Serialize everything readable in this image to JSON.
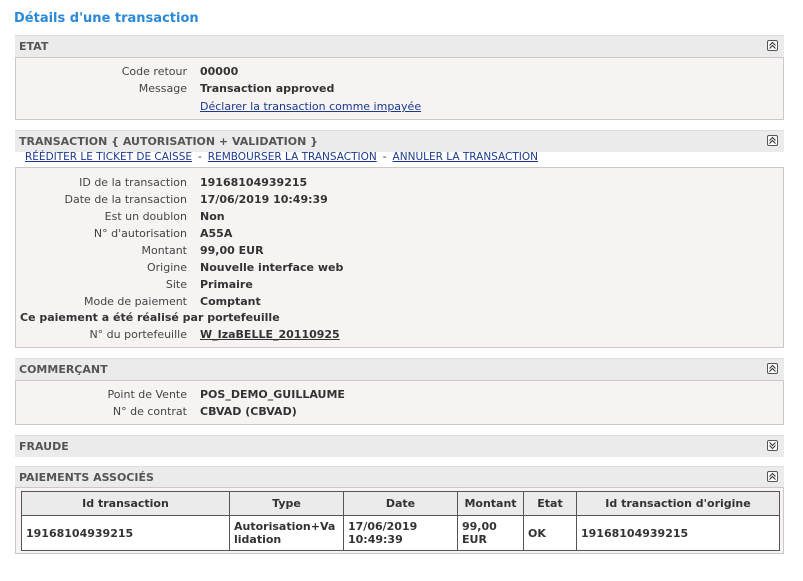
{
  "page": {
    "title": "Détails d'une transaction"
  },
  "etat": {
    "header": "ETAT",
    "code_retour_label": "Code retour",
    "code_retour_value": "00000",
    "message_label": "Message",
    "message_value": "Transaction approved",
    "declare_link": "Déclarer la transaction comme impayée"
  },
  "transaction": {
    "header": "TRANSACTION { AUTORISATION + VALIDATION }",
    "actions": [
      "RÉÉDITER LE TICKET DE CAISSE",
      "REMBOURSER LA TRANSACTION",
      "ANNULER LA TRANSACTION"
    ],
    "separator": "-",
    "fields": [
      {
        "label": "ID de la transaction",
        "value": "19168104939215"
      },
      {
        "label": "Date de la transaction",
        "value": "17/06/2019 10:49:39"
      },
      {
        "label": "Est un doublon",
        "value": "Non"
      },
      {
        "label": "N° d'autorisation",
        "value": "A55A"
      },
      {
        "label": "Montant",
        "value": "99,00 EUR"
      },
      {
        "label": "Origine",
        "value": "Nouvelle interface web"
      },
      {
        "label": "Site",
        "value": "Primaire"
      },
      {
        "label": "Mode de paiement",
        "value": "Comptant"
      }
    ],
    "wallet_note": "Ce paiement a été réalisé par portefeuille",
    "wallet_label": "N° du portefeuille",
    "wallet_value": "W_IzaBELLE_20110925"
  },
  "commercant": {
    "header": "COMMERÇANT",
    "pos_label": "Point de Vente",
    "pos_value": "POS_DEMO_GUILLAUME",
    "contract_label": "N° de contrat",
    "contract_value": "CBVAD (CBVAD)"
  },
  "fraude": {
    "header": "FRAUDE"
  },
  "paiements": {
    "header": "PAIEMENTS ASSOCIÉS",
    "columns": [
      "Id transaction",
      "Type",
      "Date",
      "Montant",
      "Etat",
      "Id transaction d'origine"
    ],
    "rows": [
      [
        "19168104939215",
        "Autorisation+Validation",
        "17/06/2019 10:49:39",
        "99,00 EUR",
        "OK",
        "19168104939215"
      ]
    ]
  },
  "icons": {
    "collapse": "collapse-up-icon",
    "expand": "expand-down-icon"
  },
  "colors": {
    "title": "#2a8ad8",
    "link": "#1a3a8a",
    "header_bg": "#ebebeb",
    "panel_bg": "#f7f3f3"
  }
}
